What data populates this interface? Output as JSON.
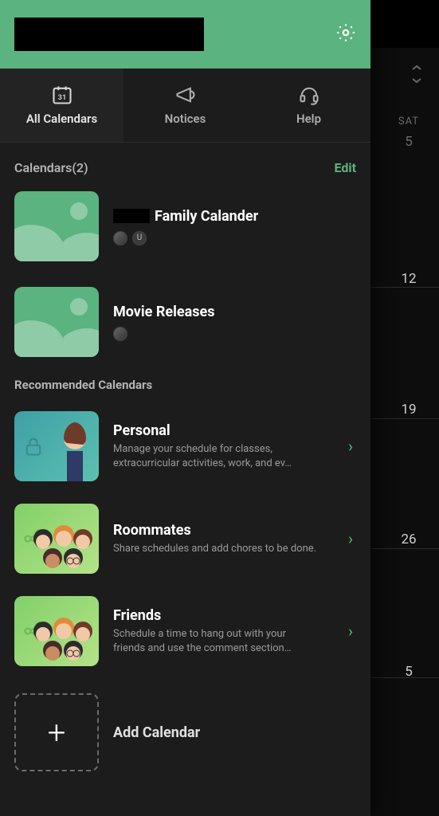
{
  "colors": {
    "accent": "#5bb37f"
  },
  "background_calendar": {
    "day_label": "SAT",
    "dates": [
      "5",
      "12",
      "19",
      "26",
      "5"
    ]
  },
  "header": {
    "logo_redacted": true
  },
  "tabs": [
    {
      "name": "all-calendars",
      "label": "All Calendars",
      "icon": "calendar-icon",
      "active": true
    },
    {
      "name": "notices",
      "label": "Notices",
      "icon": "megaphone-icon",
      "active": false
    },
    {
      "name": "help",
      "label": "Help",
      "icon": "headset-icon",
      "active": false
    }
  ],
  "calendars_section": {
    "title": "Calendars(2)",
    "edit_label": "Edit",
    "items": [
      {
        "name_prefix_redacted": true,
        "name": "Family Calander",
        "avatars": [
          "image",
          "U"
        ]
      },
      {
        "name_prefix_redacted": false,
        "name": "Movie Releases",
        "avatars": [
          "image"
        ]
      }
    ]
  },
  "recommended": {
    "title": "Recommended Calendars",
    "items": [
      {
        "name": "Personal",
        "desc": "Manage your schedule for classes, extracurricular activities, work, and ev…",
        "thumb": "teal-person",
        "locked": true
      },
      {
        "name": "Roommates",
        "desc": "Share schedules and add chores to be done.",
        "thumb": "green-group",
        "locked": false
      },
      {
        "name": "Friends",
        "desc": "Schedule a time to hang out with your friends and use the comment section…",
        "thumb": "green-group",
        "locked": false
      }
    ]
  },
  "add": {
    "label": "Add Calendar"
  }
}
